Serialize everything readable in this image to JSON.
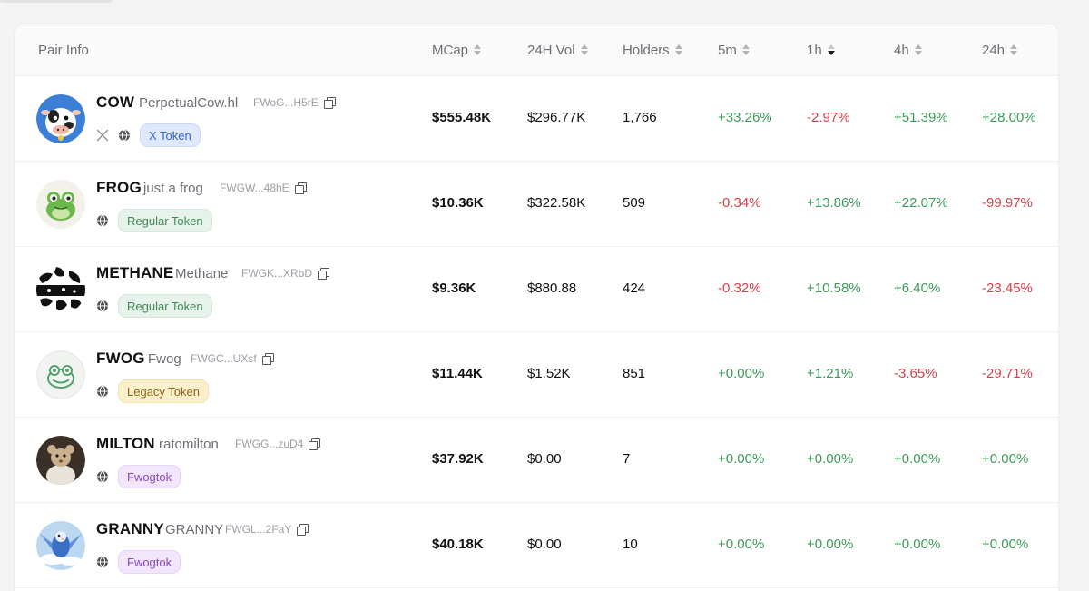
{
  "headers": {
    "pair_info": "Pair Info",
    "mcap": "MCap",
    "vol24": "24H Vol",
    "holders": "Holders",
    "m5": "5m",
    "h1": "1h",
    "h4": "4h",
    "h24": "24h"
  },
  "colors": {
    "positive": "#3f9a5a",
    "negative": "#d8414b",
    "accent": "#3366cc"
  },
  "rows": [
    {
      "symbol": "COW",
      "name": "PerpetualCow.hl",
      "address": "FWoG...H5rE",
      "badge": "X Token",
      "avatar_icon": "cow-icon",
      "mcap": "$555.48K",
      "vol24": "$296.77K",
      "holders": "1,766",
      "m5": "+33.26%",
      "h1": "-2.97%",
      "h4": "+51.39%",
      "h24": "+28.00%"
    },
    {
      "symbol": "FROG",
      "name": "just a frog",
      "address": "FWGW...48hE",
      "badge": "Regular Token",
      "avatar_icon": "frog-icon",
      "mcap": "$10.36K",
      "vol24": "$322.58K",
      "holders": "509",
      "m5": "-0.34%",
      "h1": "+13.86%",
      "h4": "+22.07%",
      "h24": "-99.97%"
    },
    {
      "symbol": "METHANE",
      "name": "Methane",
      "address": "FWGK...XRbD",
      "badge": "Regular Token",
      "avatar_icon": "cow-pattern-icon",
      "mcap": "$9.36K",
      "vol24": "$880.88",
      "holders": "424",
      "m5": "-0.32%",
      "h1": "+10.58%",
      "h4": "+6.40%",
      "h24": "-23.45%"
    },
    {
      "symbol": "FWOG",
      "name": "Fwog",
      "address": "FWGC...UXsf",
      "badge": "Legacy Token",
      "avatar_icon": "fwog-face-icon",
      "mcap": "$11.44K",
      "vol24": "$1.52K",
      "holders": "851",
      "m5": "+0.00%",
      "h1": "+1.21%",
      "h4": "-3.65%",
      "h24": "-29.71%"
    },
    {
      "symbol": "MILTON",
      "name": "ratomilton",
      "address": "FWGG...zuD4",
      "badge": "Fwogtok",
      "avatar_icon": "rat-icon",
      "mcap": "$37.92K",
      "vol24": "$0.00",
      "holders": "7",
      "m5": "+0.00%",
      "h1": "+0.00%",
      "h4": "+0.00%",
      "h24": "+0.00%"
    },
    {
      "symbol": "GRANNY",
      "name": "GRANNY",
      "address": "FWGL...2FaY",
      "badge": "Fwogtok",
      "avatar_icon": "bird-icon",
      "mcap": "$40.18K",
      "vol24": "$0.00",
      "holders": "10",
      "m5": "+0.00%",
      "h1": "+0.00%",
      "h4": "+0.00%",
      "h24": "+0.00%"
    }
  ]
}
